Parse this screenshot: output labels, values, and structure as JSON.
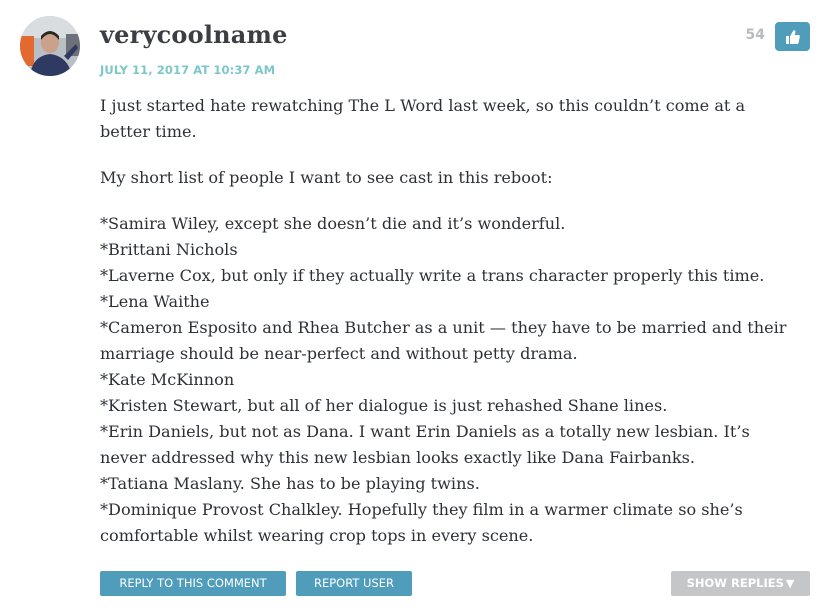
{
  "comment": {
    "username": "verycoolname",
    "date": "JULY 11, 2017 AT 10:37 AM",
    "likes": "54",
    "like_icon": "thumbs-up-icon",
    "paragraphs": [
      {
        "lines": [
          "I just started hate rewatching The L Word last week, so this couldn’t come at a better time."
        ]
      },
      {
        "lines": [
          "My short list of people I want to see cast in this reboot:"
        ]
      },
      {
        "lines": [
          "*Samira Wiley, except she doesn’t die and it’s wonderful.",
          "*Brittani Nichols",
          "*Laverne Cox, but only if they actually write a trans character properly this time.",
          "*Lena Waithe",
          "*Cameron Esposito and Rhea Butcher as a unit — they have to be married and their marriage should be near-perfect and without petty drama.",
          "*Kate McKinnon",
          "*Kristen Stewart, but all of her dialogue is just rehashed Shane lines.",
          "*Erin Daniels, but not as Dana. I want Erin Daniels as a totally new lesbian. It’s never addressed why this new lesbian looks exactly like Dana Fairbanks.",
          "*Tatiana Maslany. She has to be playing twins.",
          "*Dominique Provost Chalkley. Hopefully they film in a warmer climate so she’s comfortable whilst wearing crop tops in every scene."
        ]
      }
    ]
  },
  "actions": {
    "reply_label": "REPLY TO THIS COMMENT",
    "report_label": "REPORT USER",
    "show_replies_label": "SHOW REPLIES",
    "show_replies_icon": "▼"
  },
  "colors": {
    "accent": "#4f9dbb",
    "date": "#7cc7c9",
    "muted_button": "#c4c6c8",
    "text": "#2d3136"
  }
}
